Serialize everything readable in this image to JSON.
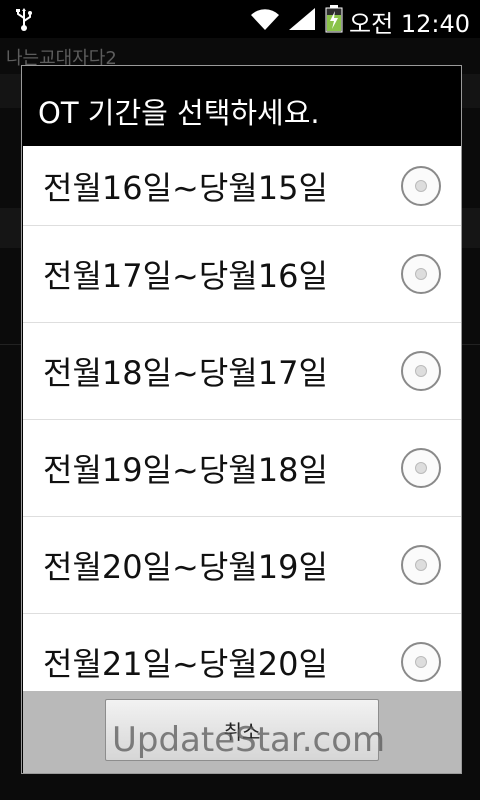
{
  "status_bar": {
    "time": "오전 12:40",
    "icons": [
      "usb-icon",
      "wifi-icon",
      "signal-icon",
      "battery-charging-icon"
    ]
  },
  "background": {
    "app_title": "나는교대자다2"
  },
  "dialog": {
    "title": "OT 기간을 선택하세요.",
    "options": [
      {
        "label": "전월16일~당월15일",
        "selected": false
      },
      {
        "label": "전월17일~당월16일",
        "selected": false
      },
      {
        "label": "전월18일~당월17일",
        "selected": false
      },
      {
        "label": "전월19일~당월18일",
        "selected": false
      },
      {
        "label": "전월20일~당월19일",
        "selected": false
      },
      {
        "label": "전월21일~당월20일",
        "selected": false
      }
    ],
    "cancel_label": "취소"
  },
  "watermark": "UpdateStar.com"
}
